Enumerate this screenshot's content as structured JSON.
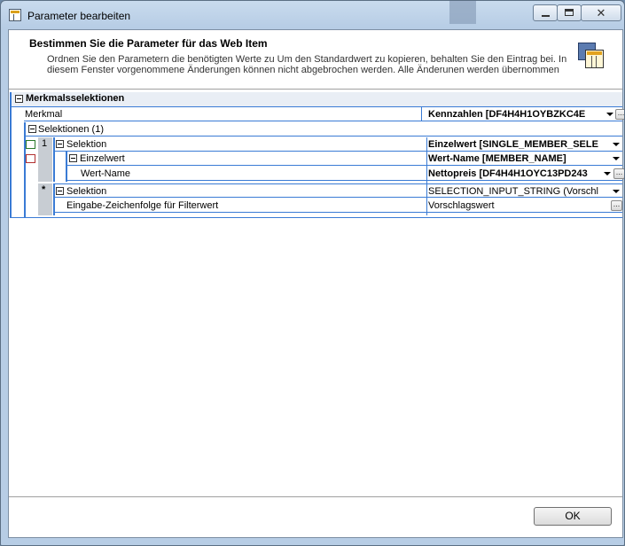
{
  "window": {
    "title": "Parameter bearbeiten",
    "controls": {
      "close_symbol": "✕"
    }
  },
  "header": {
    "title": "Bestimmen Sie die Parameter für das Web Item",
    "description": "Ordnen Sie den Parametern die benötigten Werte zu Um den Standardwert zu kopieren, behalten Sie den Eintrag bei. In diesem Fenster vorgenommene Änderungen können nicht abgebrochen werden. Alle Änderunen werden übernommen"
  },
  "grid": {
    "section_title": "Merkmalsselektionen",
    "merkmal": {
      "label": "Merkmal",
      "value": "Kennzahlen [DF4H4H1OYBZKC4E"
    },
    "selektionen_label": "Selektionen (1)",
    "row_number": "1",
    "new_row_marker": "*",
    "selektion_1": {
      "label": "Selektion",
      "value": "Einzelwert [SINGLE_MEMBER_SELE"
    },
    "einzelwert": {
      "label": "Einzelwert",
      "value": "Wert-Name [MEMBER_NAME]"
    },
    "wert_name": {
      "label": "Wert-Name",
      "value": "Nettopreis [DF4H4H1OYC13PD243"
    },
    "selektion_2": {
      "label": "Selektion",
      "value": "SELECTION_INPUT_STRING (Vorschl"
    },
    "eingabe": {
      "label": "Eingabe-Zeichenfolge für Filterwert",
      "value": "Vorschlagswert"
    },
    "ellipsis": "..."
  },
  "footer": {
    "ok_label": "OK"
  },
  "colors": {
    "accent": "#3a7bd5",
    "title_bg": "#b7cde5"
  }
}
